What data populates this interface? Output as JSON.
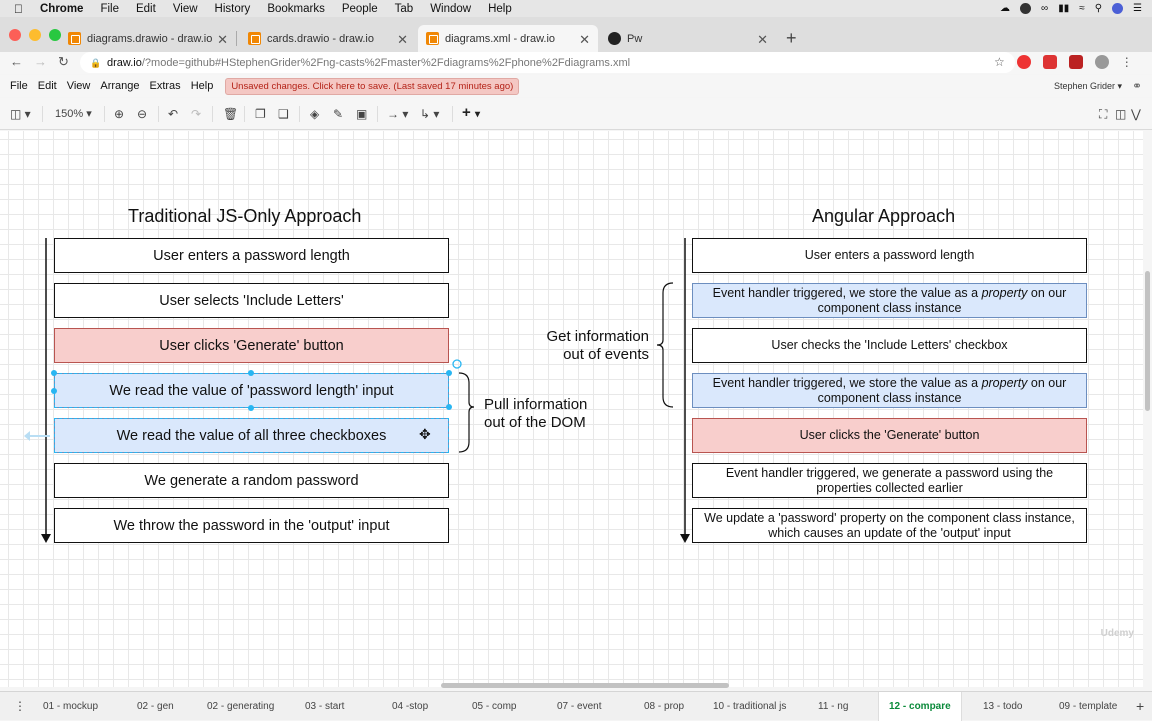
{
  "macos_menu": {
    "app": "Chrome",
    "items": [
      "File",
      "Edit",
      "View",
      "History",
      "Bookmarks",
      "People",
      "Tab",
      "Window",
      "Help"
    ]
  },
  "browser": {
    "tabs": [
      {
        "title": "diagrams.drawio - draw.io",
        "icon": "drawio-icon"
      },
      {
        "title": "cards.drawio - draw.io",
        "icon": "drawio-icon"
      },
      {
        "title": "diagrams.xml - draw.io",
        "icon": "drawio-icon"
      },
      {
        "title": "Pw",
        "icon": "angular-icon"
      }
    ],
    "new_tab": "+",
    "url_host": "draw.io",
    "url_path": "/?mode=github#HStephenGrider%2Fng-casts%2Fmaster%2Fdiagrams%2Fphone%2Fdiagrams.xml"
  },
  "drawio_menu": {
    "items": [
      "File",
      "Edit",
      "View",
      "Arrange",
      "Extras",
      "Help"
    ],
    "unsaved_notice": "Unsaved changes. Click here to save. (Last saved 17 minutes ago)",
    "user": "Stephen Grider ▾"
  },
  "toolbar": {
    "zoom": "150%"
  },
  "diagram": {
    "left_title": "Traditional JS-Only Approach",
    "left_steps": [
      "User enters a password length",
      "User selects 'Include Letters'",
      "User clicks 'Generate' button",
      "We read the value of 'password length' input",
      "We read the value of all three checkboxes",
      "We generate a random password",
      "We throw the password in the 'output' input"
    ],
    "left_note_line1": "Pull information",
    "left_note_line2": "out of the DOM",
    "right_title": "Angular Approach",
    "right_steps": [
      "User enters a password length",
      "Event handler triggered, we store the value as a",
      "property",
      "on our component class instance",
      "User checks the 'Include Letters' checkbox",
      "Event handler triggered, we store the value as a",
      "property",
      "on our component class instance",
      "User clicks the 'Generate' button",
      "Event handler triggered, we generate a password using the properties collected earlier",
      "We update a 'password' property on the component class instance, which causes an update of the 'output' input"
    ],
    "right_note_line1": "Get information",
    "right_note_line2": "out of events"
  },
  "sheets": [
    "01 - mockup",
    "02 - gen",
    "02 - generating",
    "03 - start",
    "04 -stop",
    "05 - comp",
    "07 - event",
    "08 - prop",
    "10 - traditional js",
    "11 - ng",
    "12 - compare",
    "13 - todo",
    "09 - template"
  ],
  "active_sheet": "12 - compare",
  "colors": {
    "blue_fill": "#dae8fc",
    "blue_stroke": "#6c8ebf",
    "red_fill": "#f8cecc",
    "red_stroke": "#b85450",
    "selection": "#29b6f2",
    "active_sheet": "#0a8a3a"
  }
}
